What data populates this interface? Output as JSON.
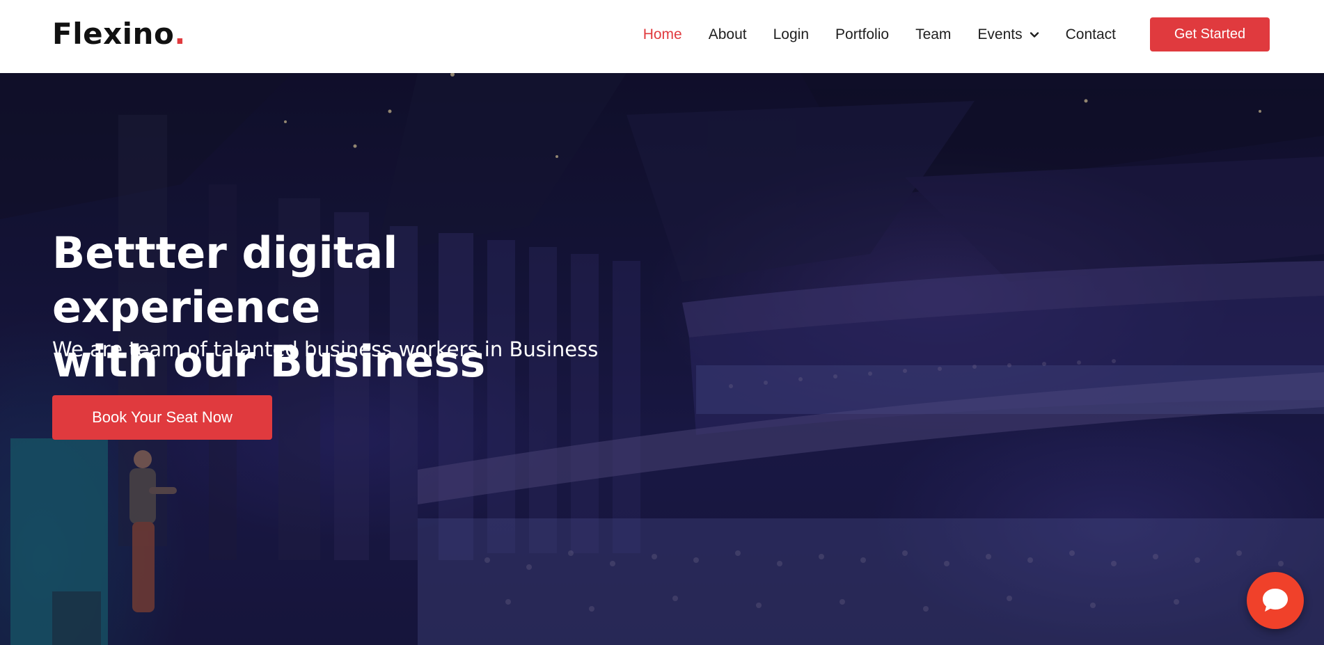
{
  "brand": {
    "name": "Flexino",
    "dot": "."
  },
  "nav": {
    "items": [
      {
        "label": "Home",
        "active": true
      },
      {
        "label": "About",
        "active": false
      },
      {
        "label": "Login",
        "active": false
      },
      {
        "label": "Portfolio",
        "active": false
      },
      {
        "label": "Team",
        "active": false
      },
      {
        "label": "Events",
        "active": false,
        "icon": "chevron-down-icon"
      },
      {
        "label": "Contact",
        "active": false
      }
    ],
    "cta_label": "Get Started"
  },
  "hero": {
    "title_line1": "Bettter digital experience",
    "title_line2": "with our Business",
    "subtitle": "We are team of talanted business workers in Business",
    "button_label": "Book Your Seat Now",
    "background_icon": "conference-hall-photo"
  },
  "chat": {
    "icon": "chat-bubble-icon"
  },
  "colors": {
    "accent": "#e03a3e",
    "chat": "#f0412a",
    "text_dark": "#1f1f1f",
    "header_bg": "#ffffff"
  }
}
